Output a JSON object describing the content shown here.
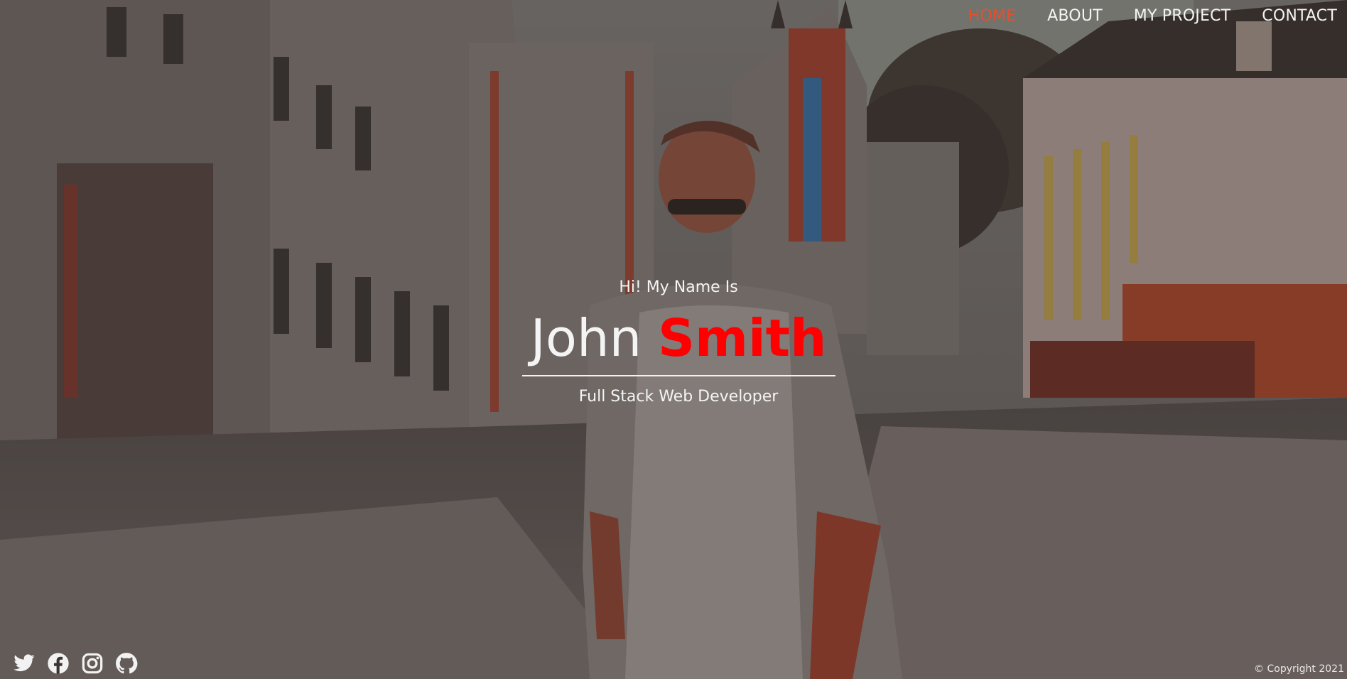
{
  "nav": {
    "items": [
      {
        "label": "HOME",
        "active": true
      },
      {
        "label": "ABOUT",
        "active": false
      },
      {
        "label": "MY PROJECT",
        "active": false
      },
      {
        "label": "CONTACT",
        "active": false
      }
    ]
  },
  "hero": {
    "greeting": "Hi! My Name Is",
    "first_name": "John",
    "last_name": "Smith",
    "role": "Full Stack Web Developer",
    "background": "street-photo"
  },
  "social": [
    {
      "icon": "twitter-icon"
    },
    {
      "icon": "facebook-icon"
    },
    {
      "icon": "instagram-icon"
    },
    {
      "icon": "github-icon"
    }
  ],
  "footer": {
    "copyright": "© Copyright 2021"
  },
  "colors": {
    "accent_nav": "#e2502f",
    "accent_name": "#ff0000",
    "text": "#f4f4f4"
  }
}
